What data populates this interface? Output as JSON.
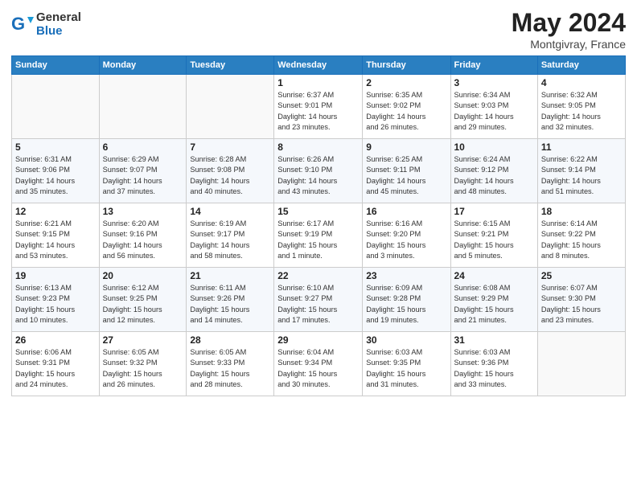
{
  "header": {
    "logo_general": "General",
    "logo_blue": "Blue",
    "title": "May 2024",
    "subtitle": "Montgivray, France"
  },
  "weekdays": [
    "Sunday",
    "Monday",
    "Tuesday",
    "Wednesday",
    "Thursday",
    "Friday",
    "Saturday"
  ],
  "weeks": [
    [
      {
        "day": "",
        "info": ""
      },
      {
        "day": "",
        "info": ""
      },
      {
        "day": "",
        "info": ""
      },
      {
        "day": "1",
        "info": "Sunrise: 6:37 AM\nSunset: 9:01 PM\nDaylight: 14 hours\nand 23 minutes."
      },
      {
        "day": "2",
        "info": "Sunrise: 6:35 AM\nSunset: 9:02 PM\nDaylight: 14 hours\nand 26 minutes."
      },
      {
        "day": "3",
        "info": "Sunrise: 6:34 AM\nSunset: 9:03 PM\nDaylight: 14 hours\nand 29 minutes."
      },
      {
        "day": "4",
        "info": "Sunrise: 6:32 AM\nSunset: 9:05 PM\nDaylight: 14 hours\nand 32 minutes."
      }
    ],
    [
      {
        "day": "5",
        "info": "Sunrise: 6:31 AM\nSunset: 9:06 PM\nDaylight: 14 hours\nand 35 minutes."
      },
      {
        "day": "6",
        "info": "Sunrise: 6:29 AM\nSunset: 9:07 PM\nDaylight: 14 hours\nand 37 minutes."
      },
      {
        "day": "7",
        "info": "Sunrise: 6:28 AM\nSunset: 9:08 PM\nDaylight: 14 hours\nand 40 minutes."
      },
      {
        "day": "8",
        "info": "Sunrise: 6:26 AM\nSunset: 9:10 PM\nDaylight: 14 hours\nand 43 minutes."
      },
      {
        "day": "9",
        "info": "Sunrise: 6:25 AM\nSunset: 9:11 PM\nDaylight: 14 hours\nand 45 minutes."
      },
      {
        "day": "10",
        "info": "Sunrise: 6:24 AM\nSunset: 9:12 PM\nDaylight: 14 hours\nand 48 minutes."
      },
      {
        "day": "11",
        "info": "Sunrise: 6:22 AM\nSunset: 9:14 PM\nDaylight: 14 hours\nand 51 minutes."
      }
    ],
    [
      {
        "day": "12",
        "info": "Sunrise: 6:21 AM\nSunset: 9:15 PM\nDaylight: 14 hours\nand 53 minutes."
      },
      {
        "day": "13",
        "info": "Sunrise: 6:20 AM\nSunset: 9:16 PM\nDaylight: 14 hours\nand 56 minutes."
      },
      {
        "day": "14",
        "info": "Sunrise: 6:19 AM\nSunset: 9:17 PM\nDaylight: 14 hours\nand 58 minutes."
      },
      {
        "day": "15",
        "info": "Sunrise: 6:17 AM\nSunset: 9:19 PM\nDaylight: 15 hours\nand 1 minute."
      },
      {
        "day": "16",
        "info": "Sunrise: 6:16 AM\nSunset: 9:20 PM\nDaylight: 15 hours\nand 3 minutes."
      },
      {
        "day": "17",
        "info": "Sunrise: 6:15 AM\nSunset: 9:21 PM\nDaylight: 15 hours\nand 5 minutes."
      },
      {
        "day": "18",
        "info": "Sunrise: 6:14 AM\nSunset: 9:22 PM\nDaylight: 15 hours\nand 8 minutes."
      }
    ],
    [
      {
        "day": "19",
        "info": "Sunrise: 6:13 AM\nSunset: 9:23 PM\nDaylight: 15 hours\nand 10 minutes."
      },
      {
        "day": "20",
        "info": "Sunrise: 6:12 AM\nSunset: 9:25 PM\nDaylight: 15 hours\nand 12 minutes."
      },
      {
        "day": "21",
        "info": "Sunrise: 6:11 AM\nSunset: 9:26 PM\nDaylight: 15 hours\nand 14 minutes."
      },
      {
        "day": "22",
        "info": "Sunrise: 6:10 AM\nSunset: 9:27 PM\nDaylight: 15 hours\nand 17 minutes."
      },
      {
        "day": "23",
        "info": "Sunrise: 6:09 AM\nSunset: 9:28 PM\nDaylight: 15 hours\nand 19 minutes."
      },
      {
        "day": "24",
        "info": "Sunrise: 6:08 AM\nSunset: 9:29 PM\nDaylight: 15 hours\nand 21 minutes."
      },
      {
        "day": "25",
        "info": "Sunrise: 6:07 AM\nSunset: 9:30 PM\nDaylight: 15 hours\nand 23 minutes."
      }
    ],
    [
      {
        "day": "26",
        "info": "Sunrise: 6:06 AM\nSunset: 9:31 PM\nDaylight: 15 hours\nand 24 minutes."
      },
      {
        "day": "27",
        "info": "Sunrise: 6:05 AM\nSunset: 9:32 PM\nDaylight: 15 hours\nand 26 minutes."
      },
      {
        "day": "28",
        "info": "Sunrise: 6:05 AM\nSunset: 9:33 PM\nDaylight: 15 hours\nand 28 minutes."
      },
      {
        "day": "29",
        "info": "Sunrise: 6:04 AM\nSunset: 9:34 PM\nDaylight: 15 hours\nand 30 minutes."
      },
      {
        "day": "30",
        "info": "Sunrise: 6:03 AM\nSunset: 9:35 PM\nDaylight: 15 hours\nand 31 minutes."
      },
      {
        "day": "31",
        "info": "Sunrise: 6:03 AM\nSunset: 9:36 PM\nDaylight: 15 hours\nand 33 minutes."
      },
      {
        "day": "",
        "info": ""
      }
    ]
  ]
}
